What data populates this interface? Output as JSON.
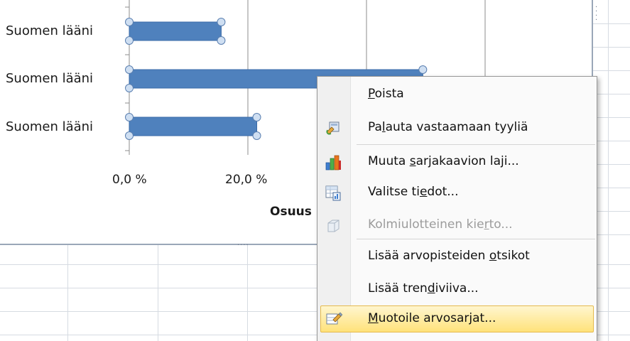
{
  "chart": {
    "categories": [
      {
        "label": "Suomen lääni"
      },
      {
        "label": "Suomen lääni"
      },
      {
        "label": "Suomen lääni"
      }
    ],
    "tick_labels": [
      "0,0 %",
      "20,0 %"
    ],
    "axis_title": "Osuus",
    "bar_color": "#4f81bd"
  },
  "chart_data": {
    "type": "bar",
    "orientation": "horizontal",
    "categories": [
      "Suomen lääni",
      "Suomen lääni",
      "Suomen lääni"
    ],
    "values": [
      15.5,
      49.5,
      21.5
    ],
    "value_unit": "%",
    "xlabel": "Osuus",
    "xticks": [
      "0,0 %",
      "20,0 %"
    ],
    "grid": true,
    "series_selected": true
  },
  "context_menu": {
    "items": [
      {
        "id": "delete",
        "pre": "",
        "key": "P",
        "post": "oista",
        "icon": "",
        "enabled": true
      },
      {
        "id": "reset-style",
        "pre": "Pa",
        "key": "l",
        "post": "auta vastaamaan tyyliä",
        "icon": "reset-style-icon",
        "enabled": true
      },
      {
        "id": "change-chart-type",
        "pre": "Muuta ",
        "key": "s",
        "post": "arjakaavion laji...",
        "icon": "chart-type-icon",
        "enabled": true
      },
      {
        "id": "select-data",
        "pre": "Valitse ti",
        "key": "e",
        "post": "dot...",
        "icon": "select-data-icon",
        "enabled": true
      },
      {
        "id": "3d-rotation",
        "pre": "Kolmiulotteinen kie",
        "key": "r",
        "post": "to...",
        "icon": "3d-rotation-icon",
        "enabled": false
      },
      {
        "id": "add-data-labels",
        "pre": "Lisää arvopisteiden ",
        "key": "o",
        "post": "tsikot",
        "icon": "",
        "enabled": true
      },
      {
        "id": "add-trendline",
        "pre": "Lisää tren",
        "key": "d",
        "post": "iviiva...",
        "icon": "",
        "enabled": true
      },
      {
        "id": "format-series",
        "pre": "",
        "key": "M",
        "post": "uotoile arvosarjat...",
        "icon": "format-series-icon",
        "enabled": true
      }
    ]
  }
}
